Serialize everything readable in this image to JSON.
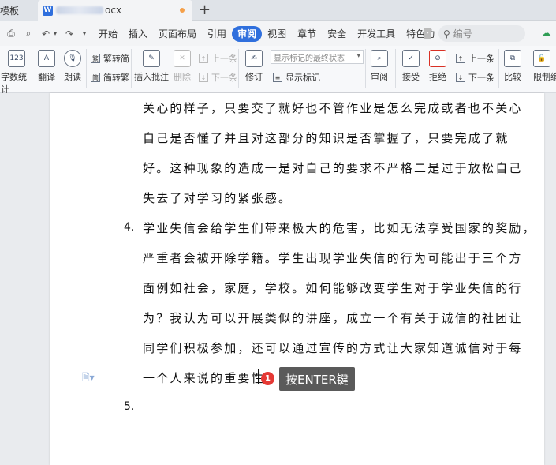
{
  "tabs": {
    "first_partial": "模板",
    "doc_name_suffix": "ocx"
  },
  "menu": {
    "items": [
      "开始",
      "插入",
      "页面布局",
      "引用",
      "审阅",
      "视图",
      "章节",
      "安全",
      "开发工具",
      "特色功"
    ],
    "active": "审阅",
    "search_placeholder": "编号"
  },
  "ribbon": {
    "word_count": "字数统计",
    "translate": "翻译",
    "read_aloud": "朗读",
    "to_traditional": "繁转简",
    "to_simplified": "简转繁",
    "insert_comment": "插入批注",
    "delete": "删除",
    "prev_comment": "上一条",
    "next_comment": "下一条",
    "revise": "修订",
    "markup_mode": "显示标记的最终状态",
    "show_markup": "显示标记",
    "review": "审阅",
    "accept": "接受",
    "reject": "拒绝",
    "prev_change": "上一条",
    "next_change": "下一条",
    "compare": "比较",
    "restrict_edit": "限制编"
  },
  "document": {
    "lines": [
      "关心的样子，只要交了就好也不管作业是怎么完成或者也不关心",
      "自己是否懂了并且对这部分的知识是否掌握了，只要完成了就",
      "好。这种现象的造成一是对自己的要求不严格二是过于放松自己",
      "失去了对学习的紧张感。"
    ],
    "item4_number": "4.",
    "item4_lines": [
      "学业失信会给学生们带来极大的危害，比如无法享受国家的奖励，",
      "严重者会被开除学籍。学生出现学业失信的行为可能出于三个方",
      "面例如社会，家庭，学校。如何能够改变学生对于学业失信的行",
      "为？我认为可以开展类似的讲座，成立一个有关于诚信的社团让",
      "同学们积极参加，还可以通过宣传的方式让大家知道诚信对于每",
      "一个人来说的重要性。"
    ],
    "item5_number": "5."
  },
  "annotation": {
    "step": "1",
    "hint": "按ENTER键"
  }
}
